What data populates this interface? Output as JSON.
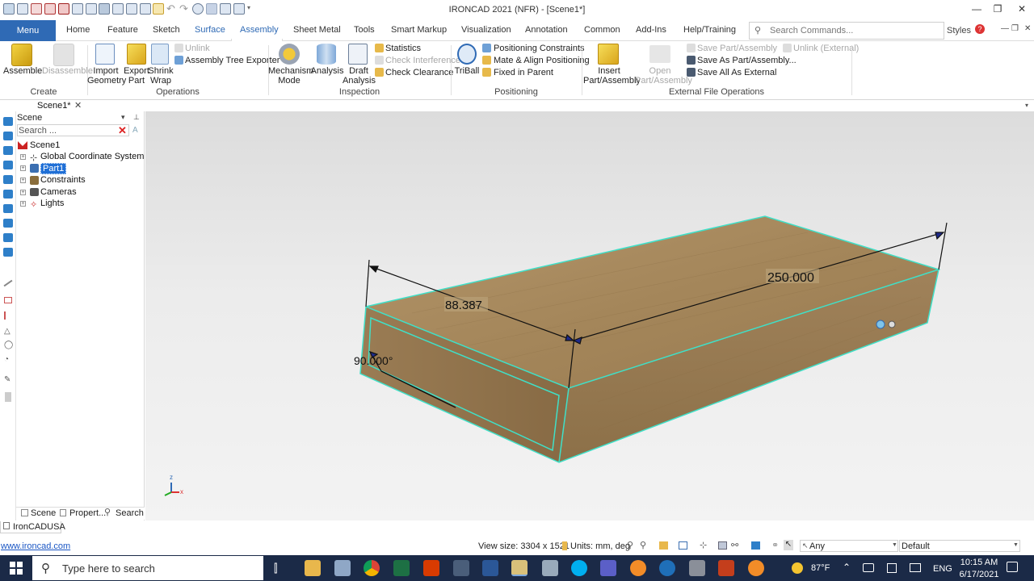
{
  "window": {
    "title": "IRONCAD 2021 (NFR) - [Scene1*]",
    "styles_label": "Styles"
  },
  "tabs": {
    "menu": "Menu",
    "items": [
      "Home",
      "Feature",
      "Sketch",
      "Surface",
      "Assembly",
      "Sheet Metal",
      "Tools",
      "Smart Markup",
      "Visualization",
      "Annotation",
      "Common",
      "Add-Ins",
      "Help/Training"
    ],
    "active": "Assembly",
    "search_placeholder": "Search Commands..."
  },
  "ribbon": {
    "create": {
      "group": "Create",
      "assemble": "Assemble",
      "disassemble": "Disassemble"
    },
    "operations": {
      "group": "Operations",
      "import_geometry": [
        "Import",
        "Geometry"
      ],
      "export_part": [
        "Export",
        "Part"
      ],
      "shrink_wrap": [
        "Shrink",
        "Wrap"
      ],
      "unlink": "Unlink",
      "assembly_tree_exporter": "Assembly Tree Exporter"
    },
    "inspection": {
      "group": "Inspection",
      "mechanism_mode": [
        "Mechanism",
        "Mode"
      ],
      "analysis": "Analysis",
      "draft_analysis": [
        "Draft",
        "Analysis"
      ],
      "statistics": "Statistics",
      "check_interference": "Check Interference",
      "check_clearance": "Check Clearance"
    },
    "positioning": {
      "group": "Positioning",
      "triball": "TriBall",
      "positioning_constraints": "Positioning Constraints",
      "mate_align": "Mate & Align Positioning",
      "fixed_in_parent": "Fixed in Parent"
    },
    "external": {
      "group": "External File Operations",
      "insert_part_assembly": [
        "Insert",
        "Part/Assembly"
      ],
      "open_part_assembly": [
        "Open",
        "Part/Assembly"
      ],
      "save_part_assembly": "Save Part/Assembly",
      "save_as_part_assembly": "Save As Part/Assembly...",
      "save_all_as_external": "Save All As External",
      "unlink_external": "Unlink (External)"
    }
  },
  "doc_tab": "Scene1*",
  "scene_panel": {
    "header": "Scene",
    "search_placeholder": "Search ...",
    "tree": {
      "root": "Scene1",
      "items": [
        "Global Coordinate System",
        "Part1",
        "Constraints",
        "Cameras",
        "Lights"
      ],
      "selected": "Part1"
    },
    "bottom_tabs": [
      "Scene",
      "Propert...",
      "Search"
    ]
  },
  "viewport": {
    "dimension_length": "250.000",
    "dimension_width": "88.387",
    "dimension_angle": "90.000°",
    "axis_x": "x",
    "axis_z": "z"
  },
  "status": {
    "company_tab": "IronCADUSA",
    "link": "www.ironcad.com",
    "view_size": "View size: 3304 x 1521",
    "units": "Units: mm, deg",
    "filter": "Any",
    "style": "Default"
  },
  "taskbar": {
    "search_placeholder": "Type here to search",
    "temperature": "87°F",
    "language": "ENG",
    "time": "10:15 AM",
    "date": "6/17/2021"
  },
  "colors": {
    "accent": "#2f6ab5",
    "selection_edge": "#3fe0c8",
    "wood": "#a88a5e",
    "taskbar": "#1b2a47"
  }
}
